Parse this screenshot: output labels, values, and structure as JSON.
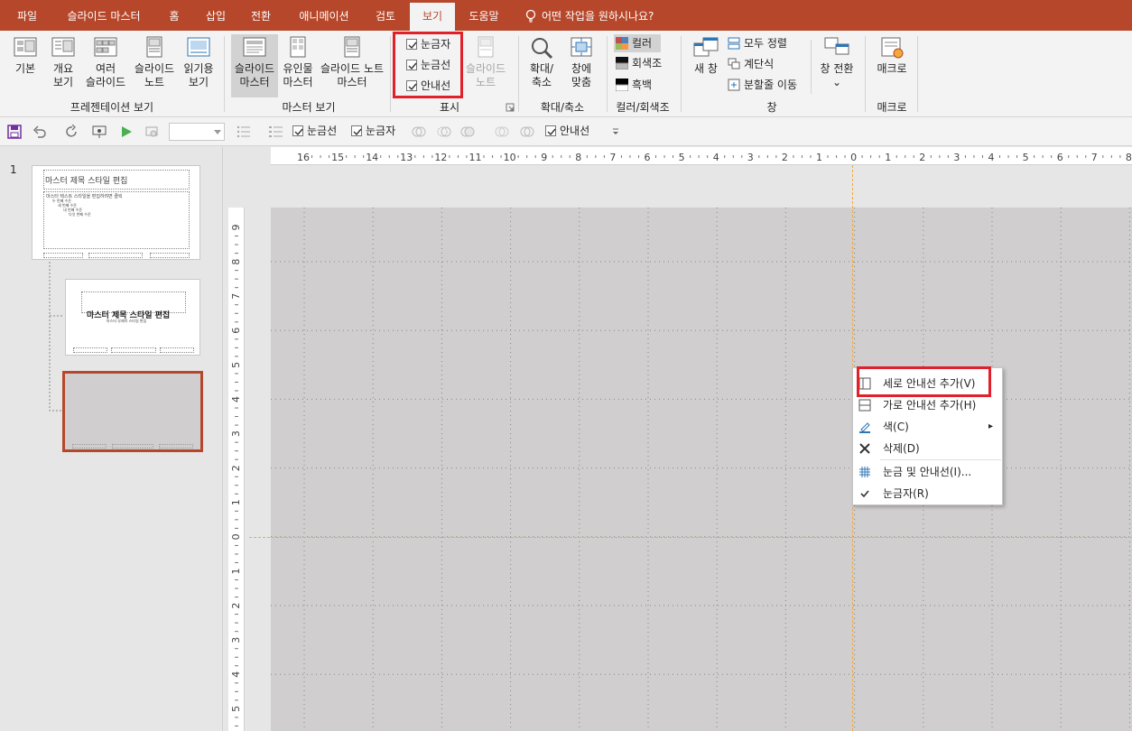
{
  "tabs": [
    {
      "label": "파일",
      "active": false
    },
    {
      "label": "슬라이드 마스터",
      "active": false
    },
    {
      "label": "홈",
      "active": false
    },
    {
      "label": "삽입",
      "active": false
    },
    {
      "label": "전환",
      "active": false
    },
    {
      "label": "애니메이션",
      "active": false
    },
    {
      "label": "검토",
      "active": false
    },
    {
      "label": "보기",
      "active": true
    },
    {
      "label": "도움말",
      "active": false
    }
  ],
  "tell_me": "어떤 작업을 원하시나요?",
  "ribbon": {
    "presentation_views": {
      "label": "프레젠테이션 보기",
      "buttons": [
        {
          "line1": "기본",
          "line2": ""
        },
        {
          "line1": "개요",
          "line2": "보기"
        },
        {
          "line1": "여러",
          "line2": "슬라이드"
        },
        {
          "line1": "슬라이드",
          "line2": "노트"
        },
        {
          "line1": "읽기용",
          "line2": "보기"
        }
      ]
    },
    "master_views": {
      "label": "마스터 보기",
      "buttons": [
        {
          "line1": "슬라이드",
          "line2": "마스터"
        },
        {
          "line1": "유인물",
          "line2": "마스터"
        },
        {
          "line1": "슬라이드 노트",
          "line2": "마스터"
        }
      ]
    },
    "show": {
      "label": "표시",
      "checks": [
        {
          "label": "눈금자",
          "checked": true
        },
        {
          "label": "눈금선",
          "checked": true
        },
        {
          "label": "안내선",
          "checked": true
        }
      ],
      "notes_button": {
        "line1": "슬라이드",
        "line2": "노트"
      }
    },
    "zoom": {
      "label": "확대/축소",
      "buttons": [
        {
          "line1": "확대/",
          "line2": "축소"
        },
        {
          "line1": "창에",
          "line2": "맞춤"
        }
      ]
    },
    "color": {
      "label": "컬러/회색조",
      "items": [
        "컬러",
        "회색조",
        "흑백"
      ]
    },
    "window": {
      "label": "창",
      "new_window": "새 창",
      "items": [
        "모두 정렬",
        "계단식",
        "분할줄 이동"
      ],
      "switch_line1": "창 전환",
      "switch_line2": "⌄"
    },
    "macros": {
      "label": "매크로",
      "button": "매크로"
    }
  },
  "qat": {
    "checks": [
      {
        "label": "눈금선",
        "checked": true
      },
      {
        "label": "눈금자",
        "checked": true
      },
      {
        "label": "안내선",
        "checked": true
      }
    ]
  },
  "thumbnails": {
    "slide_number": "1",
    "master_title": "마스터 제목 스타일 편집",
    "master_body": "마스터 텍스트 스타일을 편집하려면 클릭",
    "master_levels": [
      "두 번째 수준",
      "세 번째 수준",
      "네 번째 수준",
      "다섯 번째 수준"
    ],
    "layout_title": "마스터 제목 스타일 편집",
    "layout_subtitle": "마스터 부제목 스타일 편집"
  },
  "rulers": {
    "horizontal": [
      "16",
      "15",
      "14",
      "13",
      "12",
      "11",
      "10",
      "9",
      "8",
      "7",
      "6",
      "5",
      "4",
      "3",
      "2",
      "1",
      "0",
      "1",
      "2",
      "3",
      "4",
      "5",
      "6",
      "7",
      "8"
    ],
    "vertical": [
      "9",
      "8",
      "7",
      "6",
      "5",
      "4",
      "3",
      "2",
      "1",
      "0",
      "1",
      "2",
      "3",
      "4",
      "5"
    ]
  },
  "context_menu": {
    "items": [
      {
        "label": "세로 안내선 추가(V)",
        "icon": "vertical-guide-icon"
      },
      {
        "label": "가로 안내선 추가(H)",
        "icon": "horizontal-guide-icon"
      },
      {
        "label": "색(C)",
        "icon": "pen-color-icon",
        "submenu": "▸"
      },
      {
        "label": "삭제(D)",
        "icon": "delete-x-icon"
      },
      {
        "label": "눈금 및 안내선(I)...",
        "icon": "grid-icon"
      },
      {
        "label": "눈금자(R)",
        "icon": "checkmark-icon"
      }
    ]
  },
  "colors": {
    "accent": "#b7472a",
    "highlight": "#e0202a",
    "guide": "#f2a93b"
  }
}
